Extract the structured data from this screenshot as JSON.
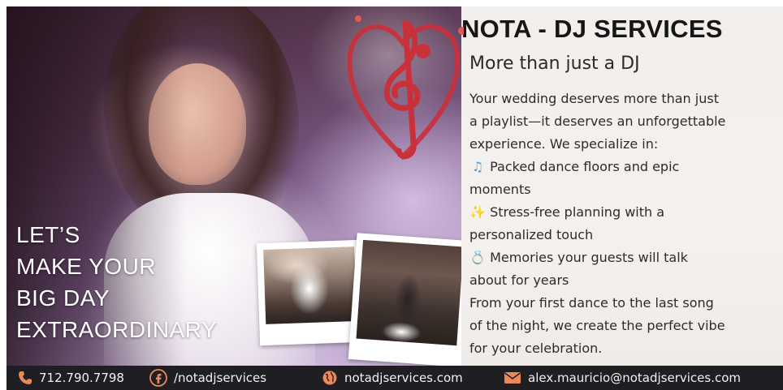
{
  "tagline": {
    "lines": [
      "LET’S",
      "MAKE YOUR",
      "BIG DAY",
      "EXTRAORDINARY"
    ]
  },
  "panel": {
    "title": "NOTA - DJ SERVICES",
    "subtitle": "More than just a DJ",
    "intro_lines": [
      "Your wedding deserves more than just",
      "a playlist—it deserves an unforgettable",
      "experience. We specialize in:"
    ],
    "bullets": [
      {
        "icon": "musical-notes-emoji",
        "line1": "Packed dance floors and epic",
        "line2": "moments"
      },
      {
        "icon": "sparkles-emoji",
        "line1": "Stress-free planning with a",
        "line2": "personalized touch"
      },
      {
        "icon": "ring-emoji",
        "line1": "Memories your guests will talk",
        "line2": "about for years"
      }
    ],
    "closing_lines": [
      "From your first dance to the last song",
      "of the night, we create the perfect vibe",
      "for your celebration."
    ]
  },
  "footer": {
    "phone": "712.790.7798",
    "facebook": "/notadjservices",
    "website": "notadjservices.com",
    "email": "alex.mauricio@notadjservices.com"
  },
  "colors": {
    "footer_bg": "#1f1e22",
    "footer_icon": "#e9895a",
    "logo_red": "#c9303a",
    "title": "#161616"
  }
}
